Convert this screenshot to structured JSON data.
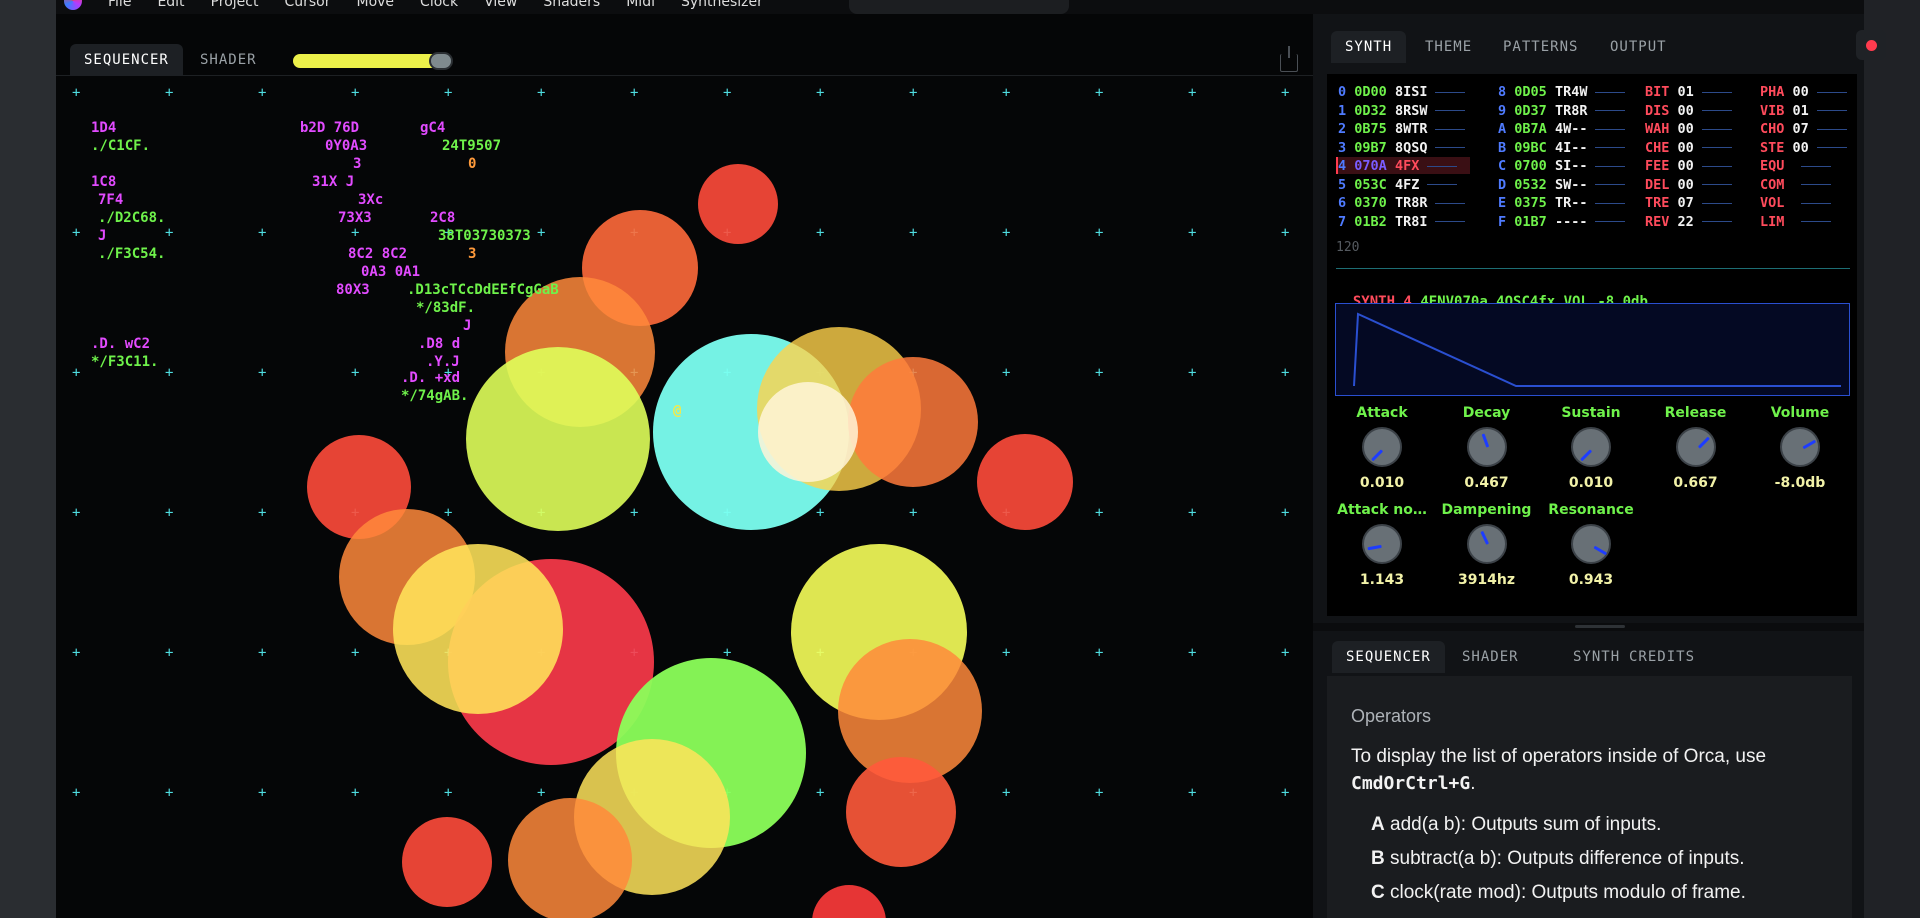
{
  "menu": {
    "items": [
      "File",
      "Edit",
      "Project",
      "Cursor",
      "Move",
      "Clock",
      "View",
      "Shaders",
      "Midi",
      "Synthesizer"
    ]
  },
  "left_tabs": [
    "SEQUENCER",
    "SHADER"
  ],
  "right_tabs_top": [
    "SYNTH",
    "THEME",
    "PATTERNS",
    "OUTPUT"
  ],
  "right_tabs_bottom": [
    "SEQUENCER",
    "SHADER",
    "SYNTH",
    "CREDITS"
  ],
  "tracks_left": [
    {
      "i": "0",
      "hex": "0D00",
      "name": "8ISI"
    },
    {
      "i": "1",
      "hex": "0D32",
      "name": "8RSW"
    },
    {
      "i": "2",
      "hex": "0B75",
      "name": "8WTR"
    },
    {
      "i": "3",
      "hex": "09B7",
      "name": "8QSQ"
    },
    {
      "i": "4",
      "hex": "070A",
      "name": "4FX"
    },
    {
      "i": "5",
      "hex": "053C",
      "name": "4FZ"
    },
    {
      "i": "6",
      "hex": "0370",
      "name": "TR8R"
    },
    {
      "i": "7",
      "hex": "01B2",
      "name": "TR8I"
    }
  ],
  "tracks_right": [
    {
      "i": "8",
      "hex": "0D05",
      "name": "TR4W"
    },
    {
      "i": "9",
      "hex": "0D37",
      "name": "TR8R"
    },
    {
      "i": "A",
      "hex": "0B7A",
      "name": "4W--"
    },
    {
      "i": "B",
      "hex": "09BC",
      "name": "4I--"
    },
    {
      "i": "C",
      "hex": "0700",
      "name": "SI--"
    },
    {
      "i": "D",
      "hex": "0532",
      "name": "SW--"
    },
    {
      "i": "E",
      "hex": "0375",
      "name": "TR--"
    },
    {
      "i": "F",
      "hex": "01B7",
      "name": "----"
    }
  ],
  "fx_a": [
    {
      "k": "BIT",
      "v": "01"
    },
    {
      "k": "DIS",
      "v": "00"
    },
    {
      "k": "WAH",
      "v": "00"
    },
    {
      "k": "CHE",
      "v": "00"
    },
    {
      "k": "FEE",
      "v": "00"
    },
    {
      "k": "DEL",
      "v": "00"
    },
    {
      "k": "TRE",
      "v": "07"
    },
    {
      "k": "REV",
      "v": "22"
    }
  ],
  "fx_b": [
    {
      "k": "PHA",
      "v": "00"
    },
    {
      "k": "VIB",
      "v": "01"
    },
    {
      "k": "CHO",
      "v": "07"
    },
    {
      "k": "STE",
      "v": "00"
    },
    {
      "k": "EQU",
      "v": ""
    },
    {
      "k": "COM",
      "v": ""
    },
    {
      "k": "VOL",
      "v": ""
    },
    {
      "k": "LIM",
      "v": ""
    }
  ],
  "bpm": "120",
  "synth_line": {
    "name": "SYNTH 4",
    "rest": "4ENV070a 4OSC4fx VOL -8.0db"
  },
  "knobs_row1": [
    {
      "label": "Attack",
      "value": "0.010",
      "angle": -135
    },
    {
      "label": "Decay",
      "value": "0.467",
      "angle": -20
    },
    {
      "label": "Sustain",
      "value": "0.010",
      "angle": -135
    },
    {
      "label": "Release",
      "value": "0.667",
      "angle": 45
    },
    {
      "label": "Volume",
      "value": "-8.0db",
      "angle": 60
    }
  ],
  "knobs_row2": [
    {
      "label": "Attack no…",
      "value": "1.143",
      "angle": -100
    },
    {
      "label": "Dampening",
      "value": "3914hz",
      "angle": -25
    },
    {
      "label": "Resonance",
      "value": "0.943",
      "angle": 120
    }
  ],
  "docs": {
    "title": "Operators",
    "intro": "To display the list of operators inside of Orca, use",
    "shortcut": "CmdOrCtrl+G",
    "ops": [
      {
        "key": "A",
        "text": "add(a b): Outputs sum of inputs."
      },
      {
        "key": "B",
        "text": "subtract(a b): Outputs difference of inputs."
      },
      {
        "key": "C",
        "text": "clock(rate mod): Outputs modulo of frame."
      }
    ]
  },
  "grid_text": [
    {
      "t": "1D4",
      "c": "#e24bff"
    },
    {
      "t": "./C1CF.",
      "c": "#6ff24b"
    },
    {
      "t": "1C8",
      "c": "#e24bff"
    },
    {
      "t": "7F4",
      "c": "#e24bff"
    },
    {
      "t": "./D2C68.",
      "c": "#6ff24b"
    },
    {
      "t": "J",
      "c": "#e24bff"
    },
    {
      "t": "./F3C54.",
      "c": "#6ff24b"
    },
    {
      "t": ".D.  wC2",
      "c": "#e24bff"
    },
    {
      "t": "*/F3C11.",
      "c": "#6ff24b"
    },
    {
      "t": "b2D 76D",
      "c": "#e24bff"
    },
    {
      "t": "0Y0A3",
      "c": "#e24bff"
    },
    {
      "t": "3",
      "c": "#e24bff"
    },
    {
      "t": "31X J",
      "c": "#e24bff"
    },
    {
      "t": "3Xc",
      "c": "#e24bff"
    },
    {
      "t": "73X3",
      "c": "#e24bff"
    },
    {
      "t": "8C2  8C2",
      "c": "#e24bff"
    },
    {
      "t": "0A3  0A1",
      "c": "#e24bff"
    },
    {
      "t": "80X3",
      "c": "#e24bff"
    },
    {
      "t": "gC4",
      "c": "#e24bff"
    },
    {
      "t": "24T9507",
      "c": "#6ff24b"
    },
    {
      "t": "0",
      "c": "#ff9a3b"
    },
    {
      "t": "2C8",
      "c": "#e24bff"
    },
    {
      "t": "38T03730373",
      "c": "#6ff24b"
    },
    {
      "t": "3",
      "c": "#ff9a3b"
    },
    {
      "t": ".D13cTCcDdEEfCgGaB",
      "c": "#6ff24b"
    },
    {
      "t": "*/83dF.",
      "c": "#6ff24b"
    },
    {
      "t": "J",
      "c": "#e24bff"
    },
    {
      "t": ".D8  d",
      "c": "#e24bff"
    },
    {
      "t": ".Y.J",
      "c": "#e24bff"
    },
    {
      "t": ".D.  +xd",
      "c": "#e24bff"
    },
    {
      "t": "*/74gAB.",
      "c": "#6ff24b"
    },
    {
      "t": "@",
      "c": "#f2e94b"
    }
  ]
}
